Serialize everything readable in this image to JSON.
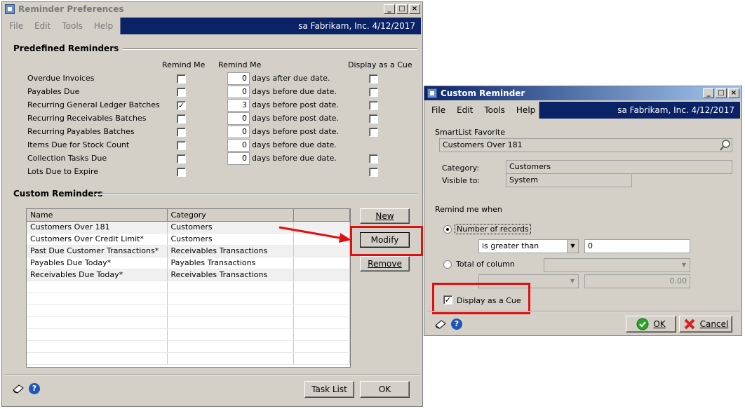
{
  "left_window": {
    "title": "Reminder Preferences",
    "menu": [
      "File",
      "Edit",
      "Tools",
      "Help"
    ],
    "user_info": "sa  Fabrikam, Inc.  4/12/2017",
    "predefined_heading": "Predefined Reminders",
    "col_remind_me_1": "Remind Me",
    "col_remind_me_2": "Remind Me",
    "col_display_cue": "Display as a Cue",
    "rows": [
      {
        "label": "Overdue Invoices",
        "checked": false,
        "days": "0",
        "suffix": "days after due date.",
        "cue": true
      },
      {
        "label": "Payables Due",
        "checked": false,
        "days": "0",
        "suffix": "days before due date.",
        "cue": true
      },
      {
        "label": "Recurring General Ledger Batches",
        "checked": true,
        "days": "3",
        "suffix": "days before post date.",
        "cue": true
      },
      {
        "label": "Recurring Receivables Batches",
        "checked": false,
        "days": "0",
        "suffix": "days before post date.",
        "cue": true
      },
      {
        "label": "Recurring Payables Batches",
        "checked": false,
        "days": "0",
        "suffix": "days before post date.",
        "cue": true
      },
      {
        "label": "Items Due for Stock Count",
        "checked": false,
        "days": "0",
        "suffix": "days before due date.",
        "cue": false
      },
      {
        "label": "Collection Tasks Due",
        "checked": false,
        "days": "0",
        "suffix": "days before due date.",
        "cue": true
      },
      {
        "label": "Lots Due to Expire",
        "checked": false,
        "days": "",
        "suffix": "",
        "cue": true
      }
    ],
    "custom_heading": "Custom Reminders",
    "grid": {
      "headers": [
        "Name",
        "Category",
        ""
      ],
      "rows": [
        [
          "Customers Over 181",
          "Customers"
        ],
        [
          "Customers Over Credit Limit*",
          "Customers"
        ],
        [
          "Past Due Customer Transactions*",
          "Receivables Transactions"
        ],
        [
          "Payables Due Today*",
          "Payables Transactions"
        ],
        [
          "Receivables Due Today*",
          "Receivables Transactions"
        ]
      ]
    },
    "btn_new": "New",
    "btn_modify": "Modify",
    "btn_remove": "Remove",
    "btn_task_list": "Task List",
    "btn_ok": "OK"
  },
  "right_window": {
    "title": "Custom Reminder",
    "menu": [
      "File",
      "Edit",
      "Tools",
      "Help"
    ],
    "user_info": "sa  Fabrikam, Inc.  4/12/2017",
    "smartlist_label": "SmartList Favorite",
    "smartlist_value": "Customers Over 181",
    "category_label": "Category:",
    "category_value": "Customers",
    "visible_label": "Visible to:",
    "visible_value": "System",
    "remind_when": "Remind me when",
    "opt_records": "Number of records",
    "condition": "is greater than",
    "condition_value": "0",
    "opt_total": "Total of column",
    "total_value": "0.00",
    "display_cue": "Display as a Cue",
    "btn_ok": "OK",
    "btn_cancel": "Cancel"
  },
  "colors": {
    "highlight_red": "#e01010",
    "menubar_blue": "#0a2266"
  }
}
